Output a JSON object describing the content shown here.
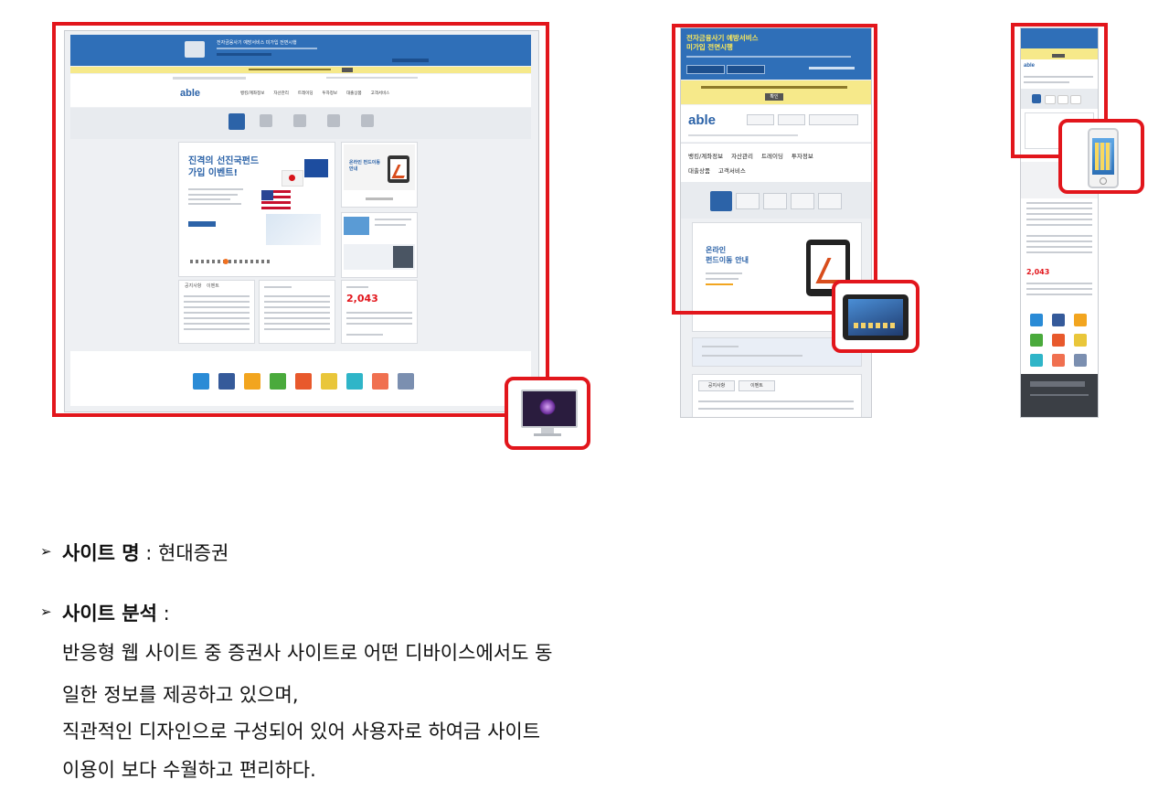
{
  "desktop": {
    "banner_title": "전자금융사기 예방서비스 미가입 전면시행",
    "brand": "able",
    "nav": [
      "뱅킹/계좌정보",
      "자산관리",
      "트레이딩",
      "투자정보",
      "대출상품",
      "고객서비스"
    ],
    "promo_title_1": "진격의 선진국펀드",
    "promo_title_2": "가입 이벤트!",
    "side_card_title": "온라인 펀드이동 안내",
    "index_value": "2,043",
    "tab_notice": "공지사항",
    "tab_event": "이벤트"
  },
  "tablet": {
    "banner_line1": "전자금융사기 예방서비스",
    "banner_line2": "미가입 전면시행",
    "brand": "able",
    "nav_row1": [
      "뱅킹/계좌정보",
      "자산관리",
      "트레이딩",
      "투자정보"
    ],
    "nav_row2": [
      "대출상품",
      "고객서비스"
    ],
    "card_title_1": "온라인",
    "card_title_2": "펀드이동 안내",
    "tab_notice": "공지사항",
    "tab_event": "이벤트",
    "notice_button": "확인"
  },
  "mobile": {
    "brand": "able",
    "index_value": "2,043"
  },
  "info": {
    "site_name_label": "사이트 명",
    "site_name_value": "현대증권",
    "analysis_label": "사이트 분석",
    "analysis_lines": [
      "반응형 웹 사이트 중 증권사 사이트로 어떤 디바이스에서도 동",
      "일한 정보를 제공하고 있으며,",
      "직관적인 디자인으로 구성되어 있어 사용자로 하여금 사이트",
      "이용이 보다 수월하고 편리하다."
    ]
  },
  "colors": {
    "highlight": "#e2161c",
    "brand_blue": "#2c63a8",
    "banner_yellow": "#f6e98a"
  }
}
